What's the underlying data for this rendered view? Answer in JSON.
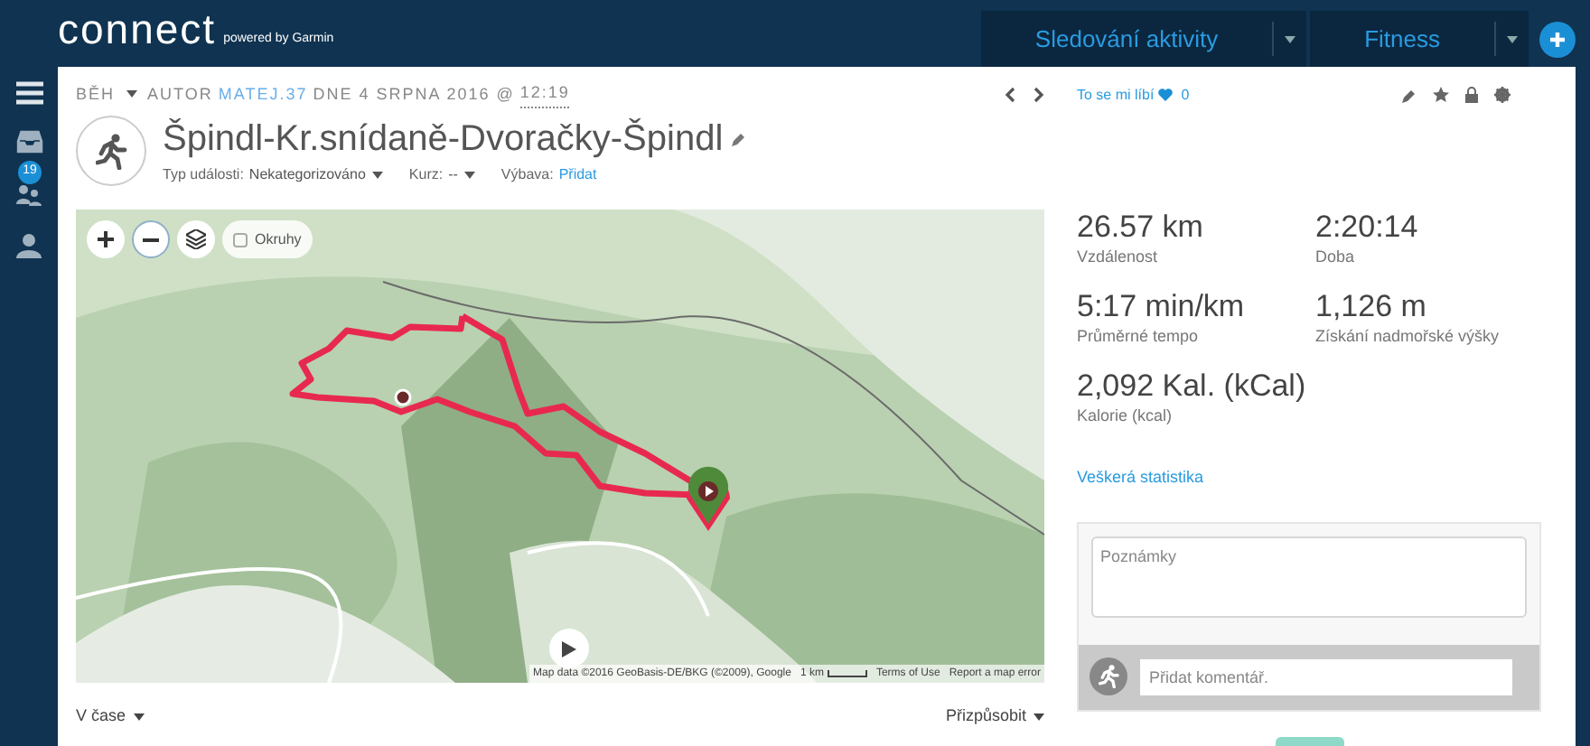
{
  "header": {
    "logo": "connect",
    "tagline": "powered by Garmin",
    "nav": [
      {
        "label": "Sledování aktivity"
      },
      {
        "label": "Fitness"
      }
    ]
  },
  "sidebar": {
    "badge": "19"
  },
  "activity": {
    "breadcrumb": {
      "type": "BĚH",
      "author_label": "AUTOR",
      "author": "MATEJ.37",
      "date": "DNE 4 SRPNA 2016 @",
      "time": "12:19"
    },
    "likes": {
      "label": "To se mi líbí",
      "count": "0"
    },
    "title": "Špindl-Kr.snídaně-Dvoračky-Špindl",
    "meta": [
      {
        "label": "Typ události:",
        "value": "Nekategorizováno",
        "kind": "dropdown"
      },
      {
        "label": "Kurz:",
        "value": "--",
        "kind": "dropdown"
      },
      {
        "label": "Výbava:",
        "value": "Přidat",
        "kind": "link"
      }
    ]
  },
  "map": {
    "laps_checkbox": {
      "label": "Okruhy",
      "checked": false
    },
    "attribution": "Map data ©2016 GeoBasis-DE/BKG (©2009), Google",
    "scale": "1 km",
    "links": [
      "Terms of Use",
      "Report a map error"
    ]
  },
  "stats": [
    {
      "value": "26.57 km",
      "label": "Vzdálenost"
    },
    {
      "value": "2:20:14",
      "label": "Doba"
    },
    {
      "value": "5:17 min/km",
      "label": "Průměrné tempo"
    },
    {
      "value": "1,126 m",
      "label": "Získání nadmořské výšky"
    },
    {
      "value": "2,092 Kal. (kCal)",
      "label": "Kalorie (kcal)"
    }
  ],
  "all_stats_link": "Veškerá statistika",
  "notes": {
    "placeholder": "Poznámky"
  },
  "comment": {
    "placeholder": "Přidat komentář."
  },
  "chart_controls": [
    {
      "label": "V čase"
    },
    {
      "label": "Přizpůsobit"
    }
  ]
}
